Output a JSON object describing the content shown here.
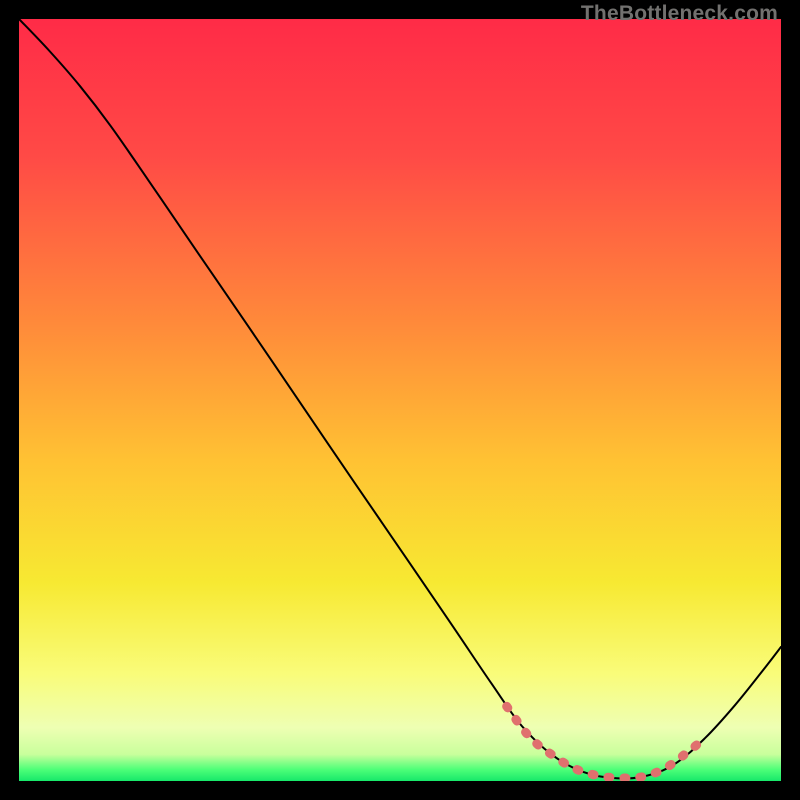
{
  "watermark": "TheBottleneck.com",
  "chart_data": {
    "type": "line",
    "title": "",
    "xlabel": "",
    "ylabel": "",
    "xlim": [
      0,
      100
    ],
    "ylim": [
      0,
      100
    ],
    "gradient_stops": [
      {
        "offset": 0.0,
        "color": "#ff2b47"
      },
      {
        "offset": 0.18,
        "color": "#ff4a46"
      },
      {
        "offset": 0.4,
        "color": "#ff8a3a"
      },
      {
        "offset": 0.58,
        "color": "#ffc233"
      },
      {
        "offset": 0.74,
        "color": "#f7e932"
      },
      {
        "offset": 0.86,
        "color": "#f9fc7a"
      },
      {
        "offset": 0.93,
        "color": "#eeffb3"
      },
      {
        "offset": 0.965,
        "color": "#c9ff9c"
      },
      {
        "offset": 0.985,
        "color": "#4dff78"
      },
      {
        "offset": 1.0,
        "color": "#17e86a"
      }
    ],
    "series": [
      {
        "name": "curve",
        "stroke": "#000000",
        "stroke_width": 2,
        "points": [
          {
            "x": 0.0,
            "y": 100.0
          },
          {
            "x": 4.0,
            "y": 95.8
          },
          {
            "x": 8.0,
            "y": 91.2
          },
          {
            "x": 12.0,
            "y": 86.0
          },
          {
            "x": 17.0,
            "y": 78.8
          },
          {
            "x": 23.0,
            "y": 70.0
          },
          {
            "x": 30.0,
            "y": 59.8
          },
          {
            "x": 37.0,
            "y": 49.5
          },
          {
            "x": 44.0,
            "y": 39.2
          },
          {
            "x": 51.0,
            "y": 29.0
          },
          {
            "x": 57.0,
            "y": 20.2
          },
          {
            "x": 62.0,
            "y": 12.8
          },
          {
            "x": 66.0,
            "y": 7.2
          },
          {
            "x": 70.0,
            "y": 3.4
          },
          {
            "x": 74.0,
            "y": 1.2
          },
          {
            "x": 78.0,
            "y": 0.4
          },
          {
            "x": 82.0,
            "y": 0.6
          },
          {
            "x": 86.0,
            "y": 2.2
          },
          {
            "x": 90.0,
            "y": 5.6
          },
          {
            "x": 94.0,
            "y": 10.0
          },
          {
            "x": 98.0,
            "y": 15.0
          },
          {
            "x": 100.0,
            "y": 17.6
          }
        ]
      },
      {
        "name": "highlight",
        "stroke": "#e0706e",
        "stroke_width": 9,
        "dash": [
          2,
          14
        ],
        "points": [
          {
            "x": 64.0,
            "y": 9.8
          },
          {
            "x": 67.0,
            "y": 5.8
          },
          {
            "x": 70.0,
            "y": 3.4
          },
          {
            "x": 73.0,
            "y": 1.6
          },
          {
            "x": 76.0,
            "y": 0.7
          },
          {
            "x": 79.0,
            "y": 0.4
          },
          {
            "x": 82.0,
            "y": 0.6
          },
          {
            "x": 85.0,
            "y": 1.8
          },
          {
            "x": 88.0,
            "y": 4.0
          },
          {
            "x": 90.0,
            "y": 5.6
          }
        ]
      }
    ]
  }
}
